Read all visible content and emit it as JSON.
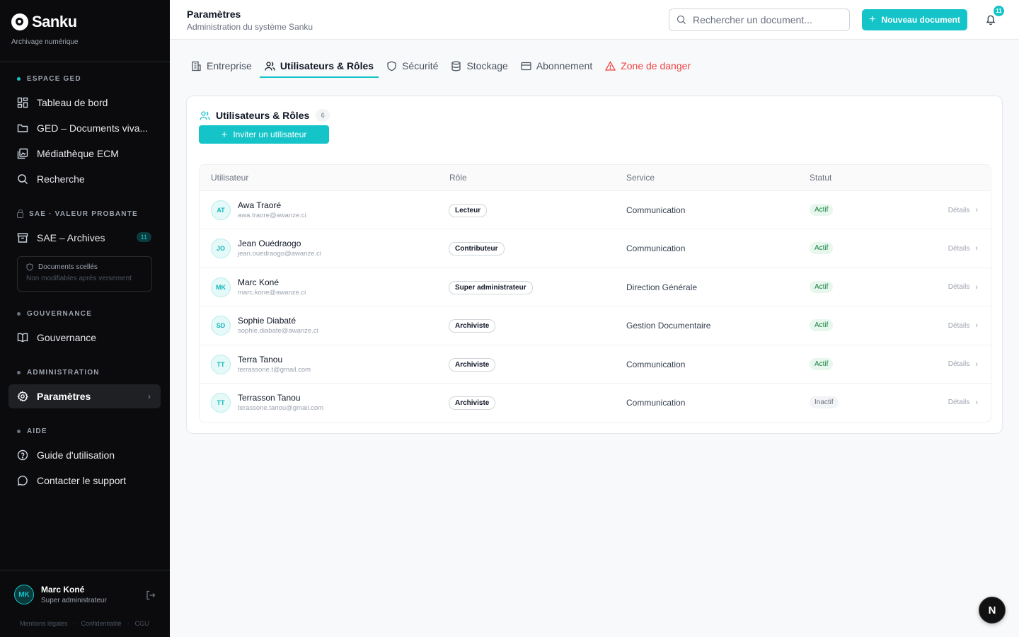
{
  "brand": {
    "name": "Sanku",
    "subtitle": "Archivage numérique"
  },
  "sidebar": {
    "sections": [
      {
        "label": "ESPACE GED"
      },
      {
        "label": "SAE · VALEUR PROBANTE"
      },
      {
        "label": "GOUVERNANCE"
      },
      {
        "label": "ADMINISTRATION"
      },
      {
        "label": "AIDE"
      }
    ],
    "items": [
      {
        "label": "Tableau de bord",
        "icon": "dashboard-icon"
      },
      {
        "label": "GED – Documents viva...",
        "icon": "folder-icon"
      },
      {
        "label": "Médiathèque ECM",
        "icon": "media-icon"
      },
      {
        "label": "Recherche",
        "icon": "search-icon"
      },
      {
        "label": "SAE – Archives",
        "icon": "archive-icon",
        "badge": "11"
      },
      {
        "label": "Gouvernance",
        "icon": "book-icon"
      },
      {
        "label": "Paramètres",
        "icon": "gear-icon",
        "active": true
      },
      {
        "label": "Guide d'utilisation",
        "icon": "help-icon"
      },
      {
        "label": "Contacter le support",
        "icon": "chat-icon"
      }
    ],
    "sealed": {
      "title": "Documents scellés",
      "subtitle": "Non modifiables après versement"
    },
    "user": {
      "initials": "MK",
      "name": "Marc Koné",
      "role": "Super administrateur"
    },
    "footer": [
      "Mentions légales",
      "·",
      "Confidentialité",
      "·",
      "CGU"
    ]
  },
  "header": {
    "title": "Paramètres",
    "subtitle": "Administration du système Sanku",
    "search_placeholder": "Rechercher un document...",
    "new_button": "Nouveau document",
    "notifications_count": "11"
  },
  "tabs": [
    {
      "label": "Entreprise",
      "icon": "building-icon"
    },
    {
      "label": "Utilisateurs & Rôles",
      "icon": "users-icon",
      "active": true
    },
    {
      "label": "Sécurité",
      "icon": "shield-icon"
    },
    {
      "label": "Stockage",
      "icon": "database-icon"
    },
    {
      "label": "Abonnement",
      "icon": "credit-card-icon"
    },
    {
      "label": "Zone de danger",
      "icon": "warning-icon",
      "danger": true
    }
  ],
  "card": {
    "title": "Utilisateurs & Rôles",
    "count": "6",
    "invite_button": "Inviter un utilisateur",
    "columns": [
      "Utilisateur",
      "Rôle",
      "Service",
      "Statut"
    ],
    "users": [
      {
        "initials": "AT",
        "name": "Awa Traoré",
        "email": "awa.traore@awanze.ci",
        "role": "Lecteur",
        "service": "Communication",
        "status": "Actif",
        "active": true,
        "details": "Détails"
      },
      {
        "initials": "JO",
        "name": "Jean Ouédraogo",
        "email": "jean.ouedraogo@awanze.ci",
        "role": "Contributeur",
        "service": "Communication",
        "status": "Actif",
        "active": true,
        "details": "Détails"
      },
      {
        "initials": "MK",
        "name": "Marc Koné",
        "email": "marc.kone@awanze.ci",
        "role": "Super administrateur",
        "service": "Direction Générale",
        "status": "Actif",
        "active": true,
        "details": "Détails"
      },
      {
        "initials": "SD",
        "name": "Sophie Diabaté",
        "email": "sophie.diabate@awanze.ci",
        "role": "Archiviste",
        "service": "Gestion Documentaire",
        "status": "Actif",
        "active": true,
        "details": "Détails"
      },
      {
        "initials": "TT",
        "name": "Terra Tanou",
        "email": "terrassone.t@gmail.com",
        "role": "Archiviste",
        "service": "Communication",
        "status": "Actif",
        "active": true,
        "details": "Détails"
      },
      {
        "initials": "TT",
        "name": "Terrasson Tanou",
        "email": "terassone.tanou@gmail.com",
        "role": "Archiviste",
        "service": "Communication",
        "status": "Inactif",
        "active": false,
        "details": "Détails"
      }
    ]
  },
  "fab": {
    "label": "N"
  },
  "colors": {
    "accent": "#14c4c8",
    "danger": "#ef4444",
    "sidebar_bg": "#0b0b0d"
  }
}
